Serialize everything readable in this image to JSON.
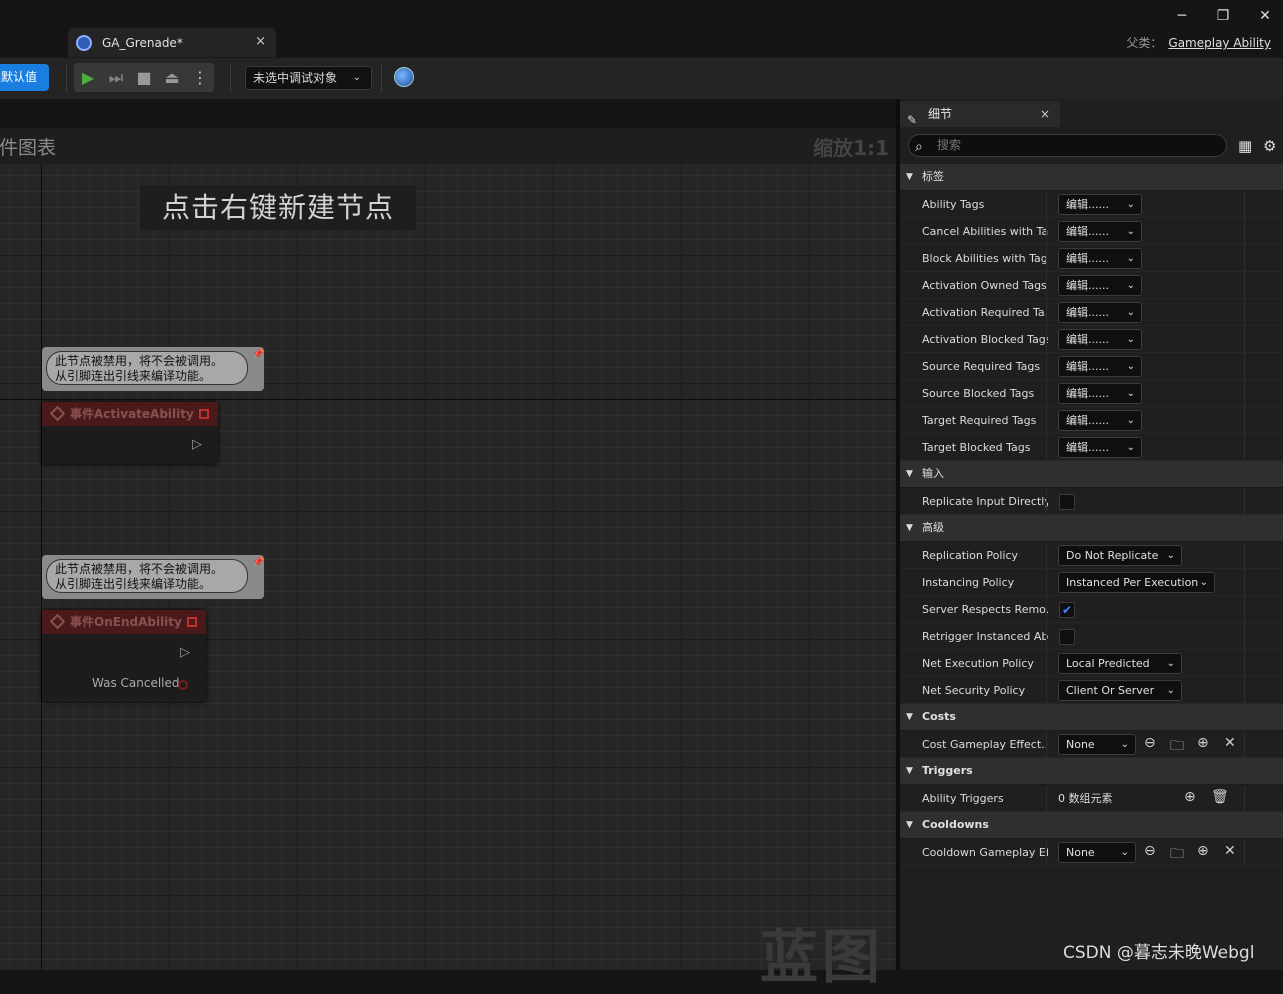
{
  "window": {
    "tab_title": "GA_Grenade*",
    "tab_close": "×",
    "minimize": "─",
    "restore": "❐",
    "close": "✕",
    "parent_label": "父类：",
    "parent_value": "Gameplay Ability"
  },
  "toolbar": {
    "default_button": "类默认值",
    "play": "▶",
    "step": "⏭",
    "stop": "■",
    "eject": "⏏",
    "more": "⋮",
    "debug_select": "未选中调试对象"
  },
  "graph": {
    "title": "事件图表",
    "zoom": "缩放1:1",
    "hint": "点击右键新建节点",
    "watermark": "蓝图",
    "nodes": [
      {
        "comment_line1": "此节点被禁用，将不会被调用。",
        "comment_line2": "从引脚连出引线来编译功能。",
        "title": "事件ActivateAbility"
      },
      {
        "comment_line1": "此节点被禁用，将不会被调用。",
        "comment_line2": "从引脚连出引线来编译功能。",
        "title": "事件OnEndAbility",
        "pin_label": "Was Cancelled"
      }
    ]
  },
  "details": {
    "tab": "细节",
    "tab_close": "×",
    "search_placeholder": "搜索",
    "categories": {
      "tags": "标签",
      "input": "输入",
      "advanced": "高级",
      "costs": "Costs",
      "triggers": "Triggers",
      "cooldowns": "Cooldowns"
    },
    "tag_rows": [
      {
        "label": "Ability Tags",
        "value": "编辑......"
      },
      {
        "label": "Cancel Abilities with Tag",
        "value": "编辑......"
      },
      {
        "label": "Block Abilities with Tag",
        "value": "编辑......"
      },
      {
        "label": "Activation Owned Tags",
        "value": "编辑......"
      },
      {
        "label": "Activation Required Ta...",
        "value": "编辑......"
      },
      {
        "label": "Activation Blocked Tags",
        "value": "编辑......"
      },
      {
        "label": "Source Required Tags",
        "value": "编辑......"
      },
      {
        "label": "Source Blocked Tags",
        "value": "编辑......"
      },
      {
        "label": "Target Required Tags",
        "value": "编辑......"
      },
      {
        "label": "Target Blocked Tags",
        "value": "编辑......"
      }
    ],
    "input_rows": [
      {
        "label": "Replicate Input Directly",
        "checked": false
      }
    ],
    "advanced_rows": [
      {
        "label": "Replication Policy",
        "value": "Do Not Replicate"
      },
      {
        "label": "Instancing Policy",
        "value": "Instanced Per Execution"
      },
      {
        "label": "Server Respects Remo...",
        "checked": true
      },
      {
        "label": "Retrigger Instanced Abi...",
        "checked": false
      },
      {
        "label": "Net Execution Policy",
        "value": "Local Predicted"
      },
      {
        "label": "Net Security Policy",
        "value": "Client Or Server"
      }
    ],
    "cost_row": {
      "label": "Cost Gameplay Effect...",
      "value": "None"
    },
    "trigger_row": {
      "label": "Ability Triggers",
      "value": "0 数组元素"
    },
    "cooldown_row": {
      "label": "Cooldown Gameplay Ef...",
      "value": "None"
    }
  },
  "footer_watermark": "CSDN @暮志未晚Webgl"
}
